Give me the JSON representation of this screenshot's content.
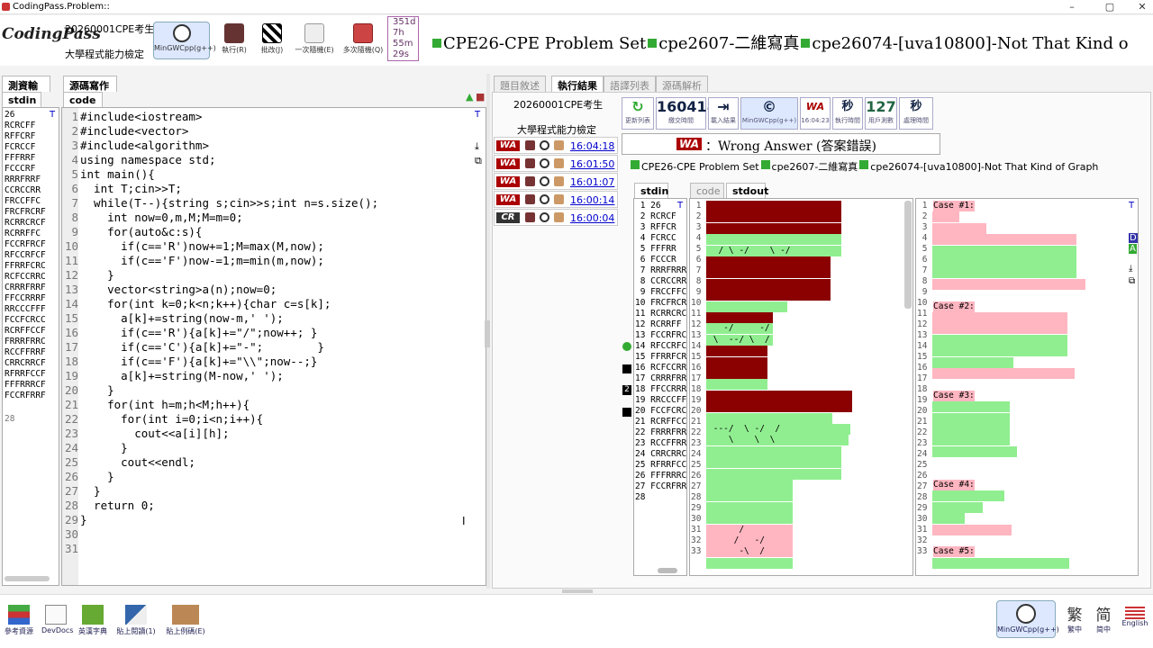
{
  "window": {
    "title": "CodingPass.Problem::"
  },
  "toolbar": {
    "logo": "CodingPass",
    "user": "20260001CPE考生",
    "exam": "大學程式能力檢定",
    "compiler": "MinGWCpp(g++)",
    "run": "執行(R)",
    "judge": "批改(J)",
    "random_once": "一次隨機(E)",
    "random_multi": "多次隨機(Q)",
    "timer": [
      "351d",
      "7h",
      "55m",
      "29s"
    ],
    "problem_title": [
      "CPE26-CPE Problem Set",
      "cpe2607-二維寫真",
      "cpe26074-[uva10800]-Not That Kind o"
    ]
  },
  "left": {
    "tabs": {
      "input": "測資輸入",
      "source": "源碼寫作"
    },
    "stdin_tab": "stdin ×",
    "code_tab": "code ×",
    "stdin_lines": [
      "26",
      "RCRCFF",
      "RFFCRF",
      "FCRCCF",
      "FFFRRF",
      "FCCCRF",
      "RRRFRRF",
      "CCRCCRR",
      "FRCCFFC",
      "FRCFRCRF",
      "RCRRCRCF",
      "RCRRFFC",
      "FCCRFRCF",
      "RFCCRFCF",
      "FFRRFCRC",
      "RCFCCRRC",
      "CRRRFRRF",
      "FFCCRRRF",
      "RRCCCFFF",
      "FCCFCRCC",
      "RCRFFCCF",
      "FRRRFRRC",
      "RCCFFRRF",
      "CRRCRRCF",
      "RFRRFCCF",
      "FFFRRRCF",
      "FCCRFRRF"
    ],
    "code_lines": [
      "#include<iostream>",
      "#include<vector>",
      "#include<algorithm>",
      "using namespace std;",
      "int main(){",
      "  int T;cin>>T;",
      "  while(T--){string s;cin>>s;int n=s.size();",
      "    int now=0,m,M;M=m=0;",
      "    for(auto&c:s){",
      "      if(c=='R')now+=1;M=max(M,now);",
      "      if(c=='F')now-=1;m=min(m,now);",
      "    }",
      "    vector<string>a(n);now=0;",
      "    for(int k=0;k<n;k++){char c=s[k];",
      "      a[k]+=string(now-m,' ');",
      "      if(c=='R'){a[k]+=\"/\";now++; }",
      "      if(c=='C'){a[k]+=\"-\";        }",
      "      if(c=='F'){a[k]+=\"\\\\\";now--;}",
      "      a[k]+=string(M-now,' ');",
      "    }",
      "    for(int h=m;h<M;h++){",
      "      for(int i=0;i<n;i++){",
      "        cout<<a[i][h];",
      "      }",
      "      cout<<endl;",
      "    }",
      "  }",
      "  return 0;",
      "}",
      "",
      ""
    ]
  },
  "right": {
    "tabs": [
      "題目敘述",
      "執行結果",
      "語譯列表",
      "源碼解析"
    ],
    "user": "20260001CPE考生",
    "exam": "大學程式能力檢定",
    "submissions": [
      {
        "verdict": "WA",
        "time": "16:04:18"
      },
      {
        "verdict": "WA",
        "time": "16:01:50"
      },
      {
        "verdict": "WA",
        "time": "16:01:07"
      },
      {
        "verdict": "WA",
        "time": "16:00:14"
      },
      {
        "verdict": "CR",
        "time": "16:00:04"
      }
    ],
    "stats": {
      "refresh": "更新列表",
      "submit_time_value": "160418",
      "submit_time": "繳交時間",
      "load_result": "載入結果",
      "compiler": "MinGWCpp(g++)",
      "verdict_time": "16:04:23",
      "exec_time_value": "秒",
      "exec_time": "執行時間",
      "user_count_value": "127",
      "user_count": "用戶測數",
      "proc_time_value": "秒",
      "proc_time": "處理時間"
    },
    "verdict_badge": "WA",
    "verdict_text": "：Wrong Answer (答案錯誤)",
    "problem_path": [
      "CPE26-CPE Problem Set",
      "cpe2607-二維寫真",
      "cpe26074-[uva10800]-Not That Kind of Graph"
    ],
    "io_tabs": {
      "stdin": "stdin",
      "code": "code",
      "stdout": "stdout"
    },
    "stdin_lines": [
      "26",
      "RCRCF",
      "RFFCR",
      "FCRCC",
      "FFFRR",
      "FCCCR",
      "RRRFRRR",
      "CCRCCRR",
      "FRCCFFC",
      "FRCFRCR",
      "RCRRCRC",
      "RCRRFF",
      "FCCRFRC",
      "RFCCRFC",
      "FFRRFCR",
      "RCFCCRR",
      "CRRRFRR",
      "FFCCRRR",
      "RRCCCFF",
      "FCCFCRC",
      "RCRFFCC",
      "FRRRFRR",
      "RCCFFRR",
      "CRRCRRC",
      "RFRRFCC",
      "FFFRRRC",
      "FCCRFRR",
      ""
    ],
    "expected_labels": [
      "Case #1:",
      "Case #2:",
      "Case #3:",
      "Case #4:",
      "Case #5:"
    ],
    "stdout_texts": [
      {
        "line": 5,
        "text": "  / \\ -/    \\ -/"
      },
      {
        "line": 12,
        "text": "   -/     -/"
      },
      {
        "line": 13,
        "text": " \\  --/ \\  /"
      },
      {
        "line": 21,
        "text": " ---/  \\ -/  /"
      },
      {
        "line": 22,
        "text": "    \\    \\  \\"
      },
      {
        "line": 30,
        "text": "      /"
      },
      {
        "line": 31,
        "text": "     /   -/"
      },
      {
        "line": 32,
        "text": "      -\\  /"
      }
    ],
    "sidebar_markers": {
      "marker2": "2",
      "letter_D": "D",
      "letter_A": "A"
    }
  },
  "bottom": {
    "ref": "參考資源",
    "devdocs": "DevDocs",
    "dict": "英漢字典",
    "paste_read": "貼上閱讀(1)",
    "paste_example": "貼上例碼(E)",
    "compiler": "MinGWCpp(g++)",
    "trad": "繁",
    "trad_label": "繁中",
    "simp": "简",
    "simp_label": "简中",
    "english": "English"
  },
  "colors": {
    "wrong": "#8b0000",
    "right": "#90ee90",
    "expected": "#ffb6c1",
    "accent": "#00a"
  }
}
